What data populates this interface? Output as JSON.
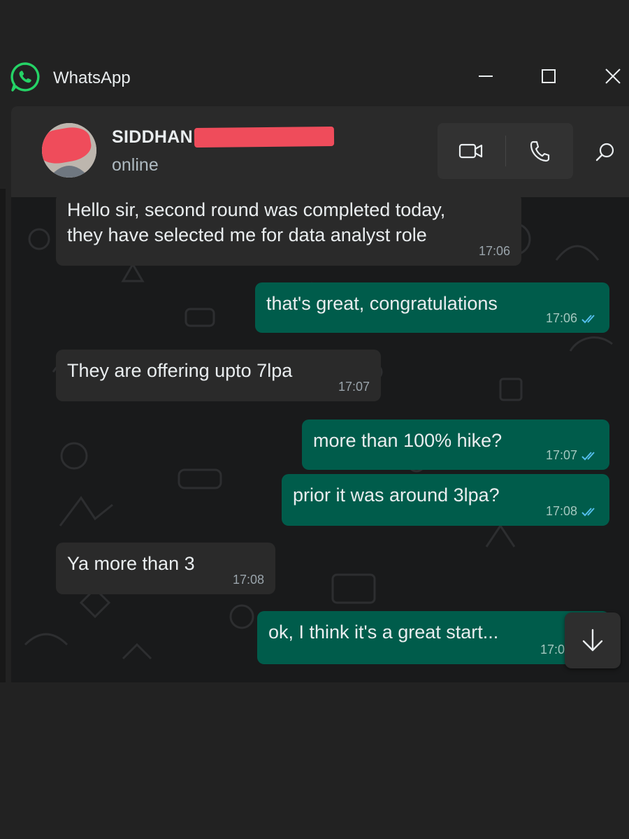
{
  "app": {
    "title": "WhatsApp",
    "logo_icon": "whatsapp-logo-icon"
  },
  "window_controls": {
    "minimize_icon": "minimize-icon",
    "maximize_icon": "maximize-icon",
    "close_icon": "close-icon"
  },
  "contact": {
    "name": "SIDDHAN",
    "status": "online"
  },
  "header_actions": {
    "video_icon": "video-camera-icon",
    "call_icon": "phone-icon",
    "search_icon": "search-icon"
  },
  "messages": [
    {
      "direction": "in",
      "lines": [
        "Hello sir, second round was completed today,",
        "they have selected me  for data analyst role"
      ],
      "time": "17:06"
    },
    {
      "direction": "out",
      "lines": [
        "that's great, congratulations"
      ],
      "time": "17:06",
      "read": true
    },
    {
      "direction": "in",
      "lines": [
        "They are offering upto 7lpa"
      ],
      "time": "17:07"
    },
    {
      "direction": "out",
      "lines": [
        "more than 100% hike?"
      ],
      "time": "17:07",
      "read": true
    },
    {
      "direction": "out",
      "lines": [
        "prior it was around 3lpa?"
      ],
      "time": "17:08",
      "read": true
    },
    {
      "direction": "in",
      "lines": [
        "Ya more than 3"
      ],
      "time": "17:08"
    },
    {
      "direction": "out",
      "lines": [
        "ok, I think it's a great start..."
      ],
      "time": "17:0",
      "read": true
    }
  ],
  "colors": {
    "incoming_bubble": "#2a2a2a",
    "outgoing_bubble": "#005c4b",
    "read_tick": "#53bdeb",
    "redaction": "#ef4c5b",
    "brand": "#25d366"
  },
  "scroll_button_icon": "arrow-down-icon"
}
